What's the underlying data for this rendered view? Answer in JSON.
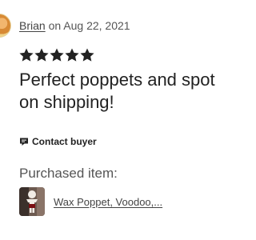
{
  "review": {
    "author": "Brian",
    "date_prefix": "on",
    "date": "Aug 22, 2021",
    "rating": 5,
    "rating_max": 5,
    "text": "Perfect poppets and spot on shipping!",
    "star_color": "#222222"
  },
  "contact": {
    "label": "Contact buyer",
    "icon": "message-icon"
  },
  "purchased": {
    "label": "Purchased item:",
    "item_title": "Wax Poppet, Voodoo,..."
  }
}
